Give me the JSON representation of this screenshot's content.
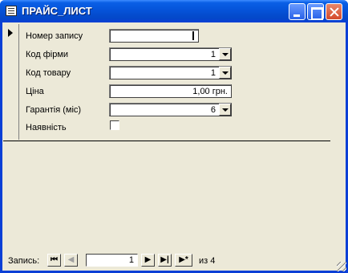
{
  "window": {
    "title": "ПРАЙС_ЛИСТ"
  },
  "fields": [
    {
      "label": "Номер запису",
      "value": ""
    },
    {
      "label": "Код фірми",
      "value": "1"
    },
    {
      "label": "Код товару",
      "value": "1"
    },
    {
      "label": "Ціна",
      "value": "1,00 грн."
    },
    {
      "label": "Гарантія (міс)",
      "value": "6"
    },
    {
      "label": "Наявність",
      "value": ""
    }
  ],
  "nav": {
    "label": "Запись:",
    "current": "1",
    "of_text": "из 4",
    "first": "⏮",
    "prev": "◀",
    "next": "▶",
    "last": "▶|",
    "new": "▶*"
  },
  "colors": {
    "titlebar": "#0a5fe6",
    "window_bg": "#ece9d8"
  }
}
